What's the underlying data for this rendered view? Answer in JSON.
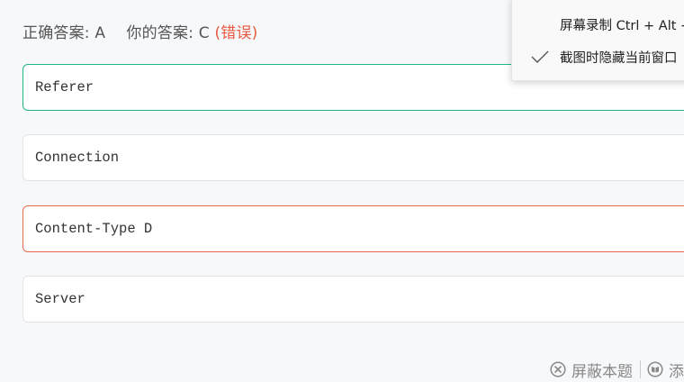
{
  "answer": {
    "correct_label": "正确答案:",
    "correct_value": "A",
    "yours_label": "你的答案:",
    "yours_value": "C",
    "status": "(错误)"
  },
  "options": [
    {
      "text": "Referer",
      "state": "correct"
    },
    {
      "text": "Connection",
      "state": "normal"
    },
    {
      "text": "Content-Type D",
      "state": "wrong"
    },
    {
      "text": "Server",
      "state": "normal"
    }
  ],
  "bottom_bar": {
    "block_label": "屏蔽本题",
    "second_label": "添",
    "block_icon": "close-circle-icon",
    "second_icon": "notebook-icon"
  },
  "context_menu": {
    "items": [
      {
        "label": "屏幕录制 Ctrl + Alt + R",
        "checked": false
      },
      {
        "label": "截图时隐藏当前窗口",
        "checked": true
      }
    ]
  },
  "colors": {
    "correct": "#1fb589",
    "wrong": "#e8573f",
    "background": "#f7f8fa"
  }
}
